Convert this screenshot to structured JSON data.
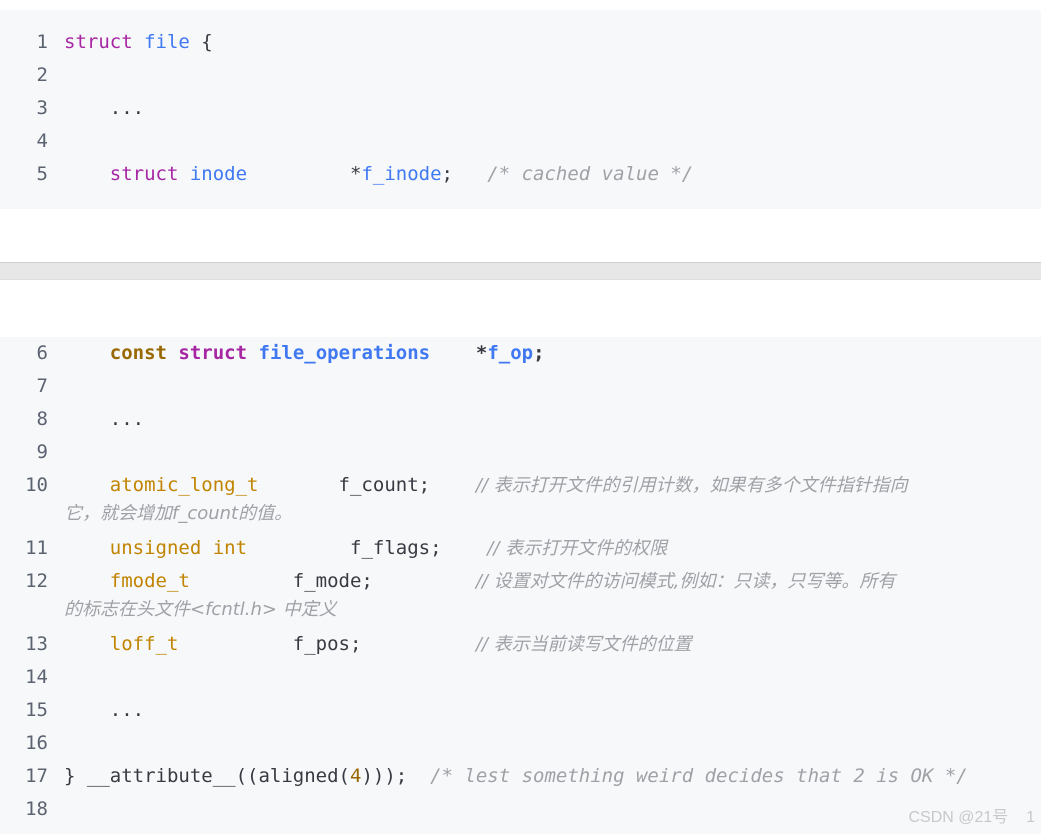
{
  "block1": [
    {
      "ln": "1",
      "tokens": [
        [
          "kw",
          "struct"
        ],
        [
          "",
          " "
        ],
        [
          "ty",
          "file"
        ],
        [
          "",
          " {"
        ]
      ]
    },
    {
      "ln": "2",
      "tokens": []
    },
    {
      "ln": "3",
      "tokens": [
        [
          "",
          "    ..."
        ]
      ]
    },
    {
      "ln": "4",
      "tokens": []
    },
    {
      "ln": "5",
      "tokens": [
        [
          "",
          "    "
        ],
        [
          "kw",
          "struct"
        ],
        [
          "",
          " "
        ],
        [
          "ty",
          "inode"
        ],
        [
          "",
          "         *"
        ],
        [
          "fn",
          "f_inode"
        ],
        [
          "",
          ";   "
        ],
        [
          "cm",
          "/* cached value */"
        ]
      ]
    }
  ],
  "block2": [
    {
      "ln": "6",
      "tokens": [
        [
          "",
          "    "
        ],
        [
          "const bold",
          "const"
        ],
        [
          "",
          " "
        ],
        [
          "kw bold",
          "struct"
        ],
        [
          "",
          " "
        ],
        [
          "ty bold",
          "file_operations"
        ],
        [
          "bold",
          "    *"
        ],
        [
          "fn bold",
          "f_op"
        ],
        [
          "bold",
          ";"
        ]
      ]
    },
    {
      "ln": "7",
      "tokens": []
    },
    {
      "ln": "8",
      "tokens": [
        [
          "",
          "    ..."
        ]
      ]
    },
    {
      "ln": "9",
      "tokens": []
    },
    {
      "ln": "10",
      "tokens": [
        [
          "",
          "    "
        ],
        [
          "ty2",
          "atomic_long_t"
        ],
        [
          "",
          "       f_count;    "
        ],
        [
          "cm-cn",
          "// 表示打开文件的引用计数，如果有多个文件指针指向"
        ]
      ],
      "cont": "它，就会增加f_count的值。"
    },
    {
      "ln": "11",
      "tokens": [
        [
          "",
          "    "
        ],
        [
          "ty2",
          "unsigned"
        ],
        [
          "",
          " "
        ],
        [
          "ty2",
          "int"
        ],
        [
          "",
          "         f_flags;    "
        ],
        [
          "cm-cn",
          "// 表示打开文件的权限"
        ]
      ]
    },
    {
      "ln": "12",
      "tokens": [
        [
          "",
          "    "
        ],
        [
          "ty2",
          "fmode_t"
        ],
        [
          "",
          "         f_mode;         "
        ],
        [
          "cm-cn",
          "// 设置对文件的访问模式,例如：只读，只写等。所有"
        ]
      ],
      "cont": "的标志在头文件<fcntl.h> 中定义"
    },
    {
      "ln": "13",
      "tokens": [
        [
          "",
          "    "
        ],
        [
          "ty2",
          "loff_t"
        ],
        [
          "",
          "          f_pos;          "
        ],
        [
          "cm-cn",
          "// 表示当前读写文件的位置"
        ]
      ]
    },
    {
      "ln": "14",
      "tokens": []
    },
    {
      "ln": "15",
      "tokens": [
        [
          "",
          "    ..."
        ]
      ]
    },
    {
      "ln": "16",
      "tokens": []
    },
    {
      "ln": "17",
      "tokens": [
        [
          "",
          "} __attribute__((aligned("
        ],
        [
          "num",
          "4"
        ],
        [
          "",
          ")));  "
        ],
        [
          "cm",
          "/* lest something weird decides that 2 is OK */"
        ]
      ]
    },
    {
      "ln": "18",
      "tokens": []
    }
  ],
  "watermark": "CSDN @21号    1"
}
